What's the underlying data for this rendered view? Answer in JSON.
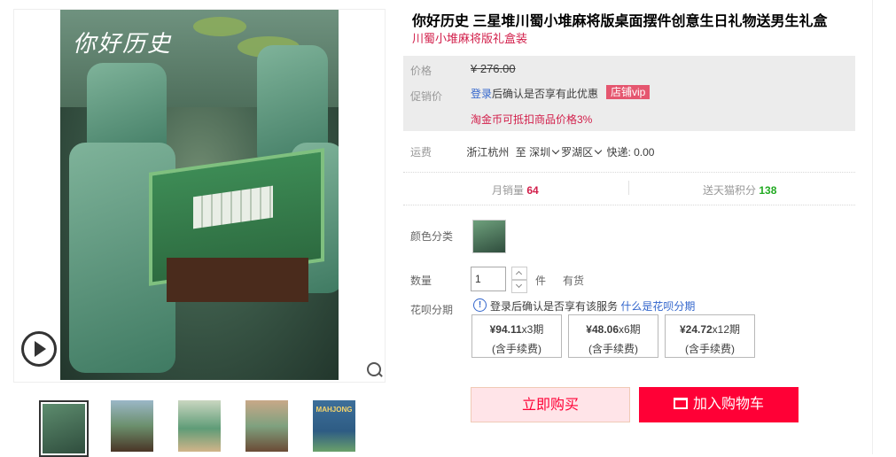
{
  "gallery": {
    "image_caption": "你好历史",
    "thumbnails": [
      {
        "label": ""
      },
      {
        "label": ""
      },
      {
        "label": ""
      },
      {
        "label": ""
      },
      {
        "label": "MAHJONG"
      }
    ]
  },
  "product": {
    "title": "你好历史 三星堆川蜀小堆麻将版桌面摆件创意生日礼物送男生礼盒",
    "subtitle": "川蜀小堆麻将版礼盒装"
  },
  "price": {
    "label": "价格",
    "original": "¥ 276.00",
    "promo_label": "促销价",
    "login_link": "登录",
    "promo_text": "后确认是否享有此优惠",
    "vip_badge": "店铺vip",
    "coin_text": "淘金币可抵扣商品价格3%"
  },
  "shipping": {
    "label": "运费",
    "from": "浙江杭州",
    "to_label": "至",
    "city": "深圳",
    "district": "罗湖区",
    "express": "快递: 0.00"
  },
  "stats": {
    "monthly_sales_label": "月销量",
    "monthly_sales_value": "64",
    "points_label": "送天猫积分",
    "points_value": "138"
  },
  "options": {
    "color_label": "颜色分类",
    "qty_label": "数量",
    "qty_value": "1",
    "qty_unit": "件",
    "stock": "有货",
    "huabei_label": "花呗分期",
    "huabei_note": "登录后确认是否享有该服务",
    "huabei_link": "什么是花呗分期",
    "plans": [
      {
        "amount": "¥94.11",
        "periods": "x3期",
        "fee": "(含手续费)"
      },
      {
        "amount": "¥48.06",
        "periods": "x6期",
        "fee": "(含手续费)"
      },
      {
        "amount": "¥24.72",
        "periods": "x12期",
        "fee": "(含手续费)"
      }
    ]
  },
  "actions": {
    "buy_now": "立即购买",
    "add_to_cart": "加入购物车"
  },
  "colors": {
    "accent_red": "#ff0036",
    "promo_pink": "#d21e4a",
    "link_blue": "#3366cc",
    "points_green": "#22aa22"
  }
}
